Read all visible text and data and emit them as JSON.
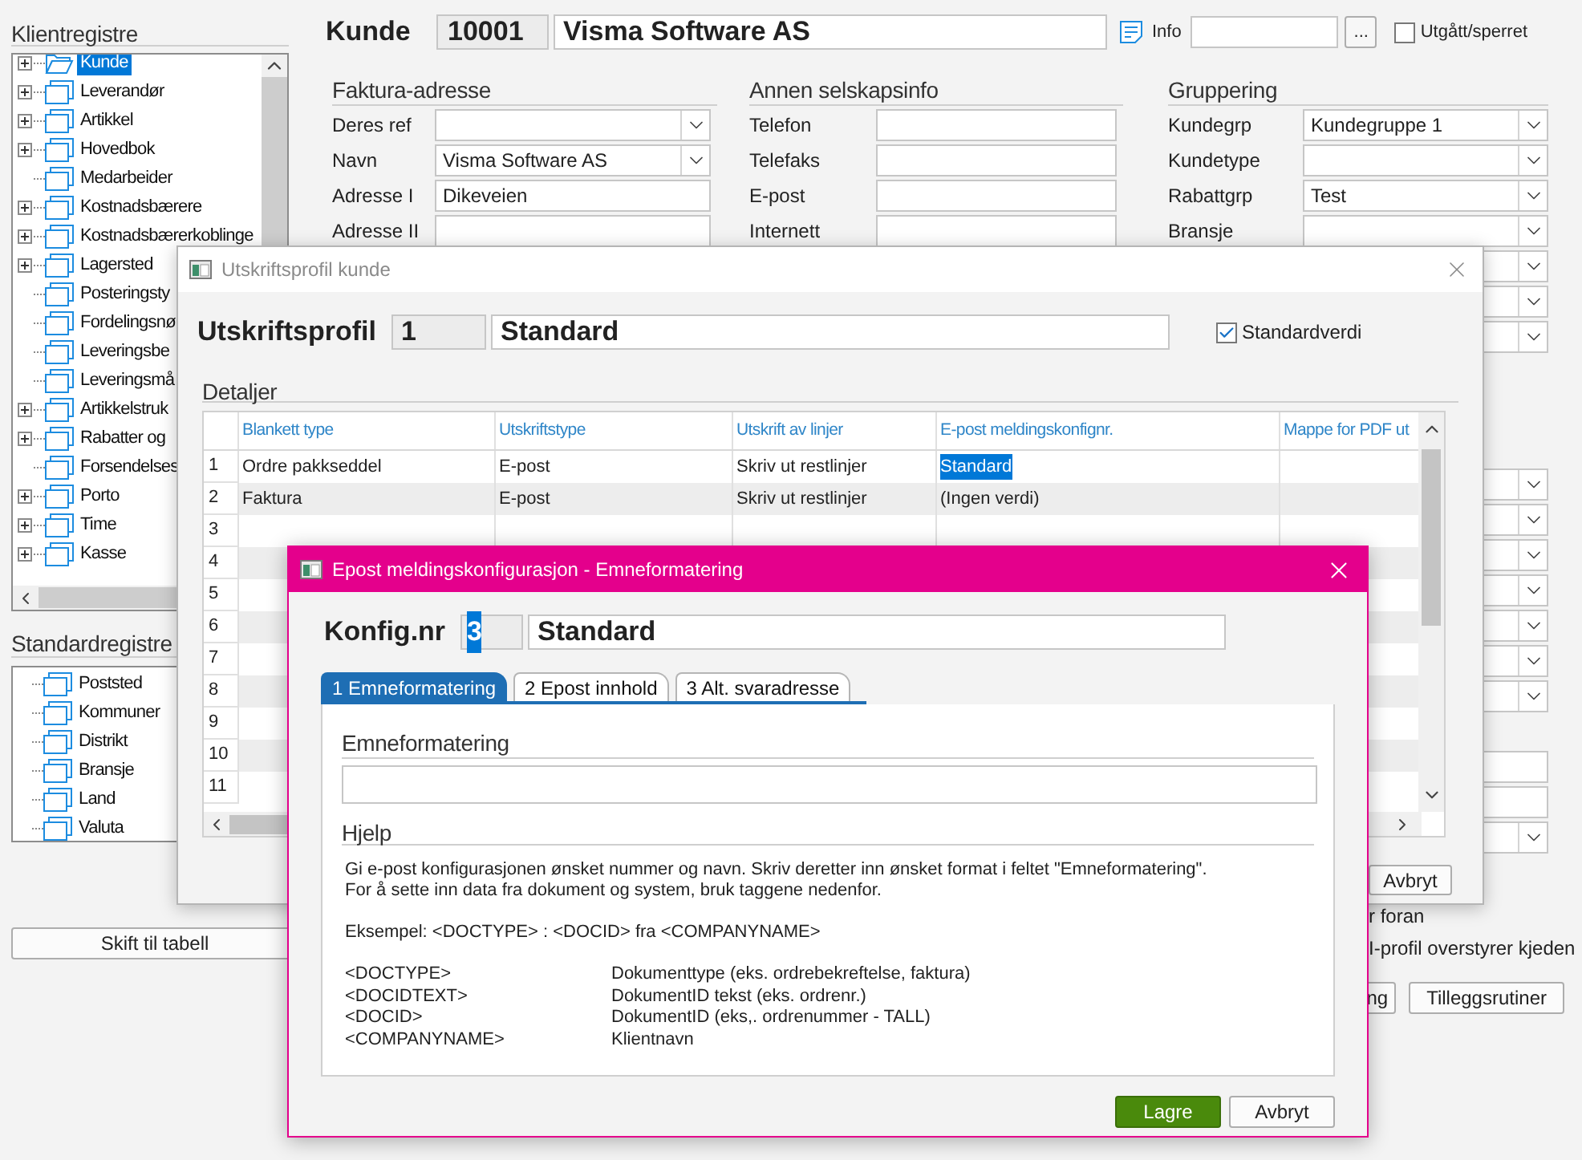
{
  "left_panel": {
    "client_registers": {
      "title": "Klientregistre",
      "items": [
        {
          "label": "Kunde",
          "expandable": true,
          "open": true,
          "selected": true
        },
        {
          "label": "Leverandør",
          "expandable": true,
          "open": false,
          "selected": false
        },
        {
          "label": "Artikkel",
          "expandable": true,
          "open": false,
          "selected": false
        },
        {
          "label": "Hovedbok",
          "expandable": true,
          "open": false,
          "selected": false
        },
        {
          "label": "Medarbeider",
          "expandable": false,
          "open": false,
          "selected": false
        },
        {
          "label": "Kostnadsbærere",
          "expandable": true,
          "open": false,
          "selected": false
        },
        {
          "label": "Kostnadsbærerkoblinge",
          "expandable": true,
          "open": false,
          "selected": false
        },
        {
          "label": "Lagersted",
          "expandable": true,
          "open": false,
          "selected": false
        },
        {
          "label": "Posteringsty",
          "expandable": false,
          "open": false,
          "selected": false
        },
        {
          "label": "Fordelingsnø",
          "expandable": false,
          "open": false,
          "selected": false
        },
        {
          "label": "Leveringsbe",
          "expandable": false,
          "open": false,
          "selected": false
        },
        {
          "label": "Leveringsmå",
          "expandable": false,
          "open": false,
          "selected": false
        },
        {
          "label": "Artikkelstruk",
          "expandable": true,
          "open": false,
          "selected": false
        },
        {
          "label": "Rabatter og",
          "expandable": true,
          "open": false,
          "selected": false
        },
        {
          "label": "Forsendelses",
          "expandable": false,
          "open": false,
          "selected": false
        },
        {
          "label": "Porto",
          "expandable": true,
          "open": false,
          "selected": false
        },
        {
          "label": "Time",
          "expandable": true,
          "open": false,
          "selected": false
        },
        {
          "label": "Kasse",
          "expandable": true,
          "open": false,
          "selected": false
        }
      ]
    },
    "standard_registers": {
      "title": "Standardregistre",
      "items": [
        {
          "label": "Poststed",
          "expandable": false,
          "open": false,
          "selected": false
        },
        {
          "label": "Kommuner",
          "expandable": false,
          "open": false,
          "selected": false
        },
        {
          "label": "Distrikt",
          "expandable": false,
          "open": false,
          "selected": false
        },
        {
          "label": "Bransje",
          "expandable": false,
          "open": false,
          "selected": false
        },
        {
          "label": "Land",
          "expandable": false,
          "open": false,
          "selected": false
        },
        {
          "label": "Valuta",
          "expandable": false,
          "open": false,
          "selected": false
        }
      ]
    },
    "switch_button": "Skift til tabell"
  },
  "customer": {
    "label": "Kunde",
    "number": "10001",
    "name": "Visma Software AS",
    "info_label": "Info",
    "browse_button": "...",
    "blocked": {
      "label": "Utgått/sperret",
      "checked": false
    }
  },
  "sections": [
    {
      "title": "Faktura-adresse",
      "fields": [
        {
          "label": "Deres ref",
          "kind": "combo"
        },
        {
          "label": "Navn",
          "kind": "combo",
          "value": "Visma Software AS"
        },
        {
          "label": "Adresse I",
          "kind": "text",
          "value": "Dikeveien"
        },
        {
          "label": "Adresse II",
          "kind": "text"
        }
      ]
    },
    {
      "title": "Annen selskapsinfo",
      "fields": [
        {
          "label": "Telefon",
          "kind": "text"
        },
        {
          "label": "Telefaks",
          "kind": "text"
        },
        {
          "label": "E-post",
          "kind": "text"
        },
        {
          "label": "Internett",
          "kind": "text"
        }
      ]
    },
    {
      "title": "Gruppering",
      "fields": [
        {
          "label": "Kundegrp",
          "kind": "combo",
          "value": "Kundegruppe 1"
        },
        {
          "label": "Kundetype",
          "kind": "combo"
        },
        {
          "label": "Rabattgrp",
          "kind": "combo",
          "value": "Test"
        },
        {
          "label": "Bransje",
          "kind": "combo"
        },
        {
          "kind": "combo"
        },
        {
          "kind": "combo"
        },
        {
          "kind": "combo"
        }
      ],
      "lower_groups": [
        {
          "fields": [
            {
              "kind": "combo"
            },
            {
              "kind": "combo"
            },
            {
              "kind": "combo"
            },
            {
              "kind": "combo"
            },
            {
              "kind": "combo"
            },
            {
              "kind": "combo"
            },
            {
              "kind": "combo"
            }
          ]
        },
        {
          "fields": [
            {
              "kind": "text"
            },
            {
              "kind": "text"
            },
            {
              "kind": "combo"
            }
          ]
        }
      ]
    }
  ],
  "options": [
    {
      "label": "r foran"
    },
    {
      "label": "I-profil overstyrer kjeden"
    }
  ],
  "bottom_buttons": [
    "ng",
    "Tilleggsrutiner"
  ],
  "print_profile_dialog": {
    "title": "Utskriftsprofil kunde",
    "label": "Utskriftsprofil",
    "number": "1",
    "name": "Standard",
    "default": {
      "label": "Standardverdi",
      "checked": true
    },
    "details_title": "Detaljer",
    "columns": [
      "Blankett type",
      "Utskriftstype",
      "Utskrift av linjer",
      "E-post meldingskonfignr.",
      "Mappe for PDF ut"
    ],
    "rows": [
      {
        "number": "1",
        "cells": [
          {
            "text": "Ordre pakkseddel",
            "selected": false
          },
          {
            "text": "E-post",
            "selected": false
          },
          {
            "text": "Skriv ut restlinjer",
            "selected": false
          },
          {
            "text": "Standard",
            "selected": true
          }
        ]
      },
      {
        "number": "2",
        "cells": [
          {
            "text": "Faktura",
            "selected": false
          },
          {
            "text": "E-post",
            "selected": false
          },
          {
            "text": "Skriv ut restlinjer",
            "selected": false
          },
          {
            "text": "(Ingen verdi)",
            "selected": false
          }
        ]
      },
      {
        "number": "3"
      },
      {
        "number": "4"
      },
      {
        "number": "5"
      },
      {
        "number": "6"
      },
      {
        "number": "7"
      },
      {
        "number": "8"
      },
      {
        "number": "9"
      },
      {
        "number": "10"
      },
      {
        "number": "11"
      }
    ],
    "cancel_button": "Avbryt"
  },
  "email_dialog": {
    "title": "Epost meldingskonfigurasjon - Emneformatering",
    "label": "Konfig.nr",
    "number": {
      "text": "3",
      "selected": true
    },
    "name": "Standard",
    "tabs": [
      {
        "label": "1 Emneformatering",
        "selected": true
      },
      {
        "label": "2 Epost innhold",
        "selected": false
      },
      {
        "label": "3 Alt. svaradresse",
        "selected": false
      }
    ],
    "subject_title": "Emneformatering",
    "help_title": "Hjelp",
    "help_lines": [
      "Gi e-post konfigurasjonen ønsket nummer og navn. Skriv deretter inn ønsket format i feltet \"Emneformatering\".",
      "For å sette inn data fra dokument og system, bruk taggene nedenfor."
    ],
    "example": "Eksempel: <DOCTYPE> : <DOCID> fra <COMPANYNAME>",
    "tags": [
      {
        "tag": "<DOCTYPE>",
        "description": "Dokumenttype (eks. ordrebekreftelse, faktura)"
      },
      {
        "tag": "<DOCIDTEXT>",
        "description": "DokumentID tekst (eks. ordrenr.)"
      },
      {
        "tag": "<DOCID>",
        "description": "DokumentID (eks,. ordrenummer - TALL)"
      },
      {
        "tag": "<COMPANYNAME>",
        "description": "Klientnavn"
      }
    ],
    "buttons": [
      {
        "label": "Lagre",
        "kind": "primary"
      },
      {
        "label": "Avbryt",
        "kind": "secondary"
      }
    ]
  }
}
